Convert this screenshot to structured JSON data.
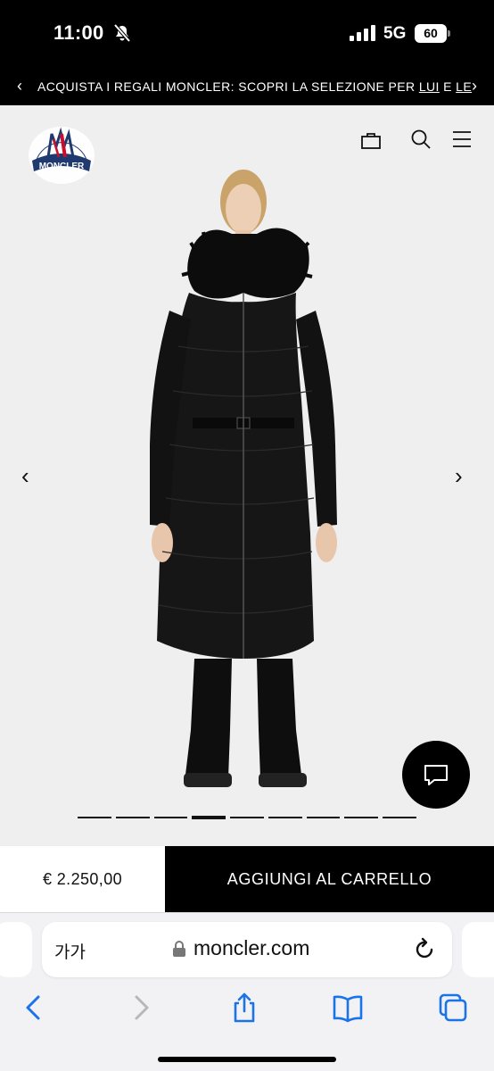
{
  "status_bar": {
    "time": "11:00",
    "network": "5G",
    "battery": "60"
  },
  "promo": {
    "text": "ACQUISTA I REGALI MONCLER: SCOPRI LA SELEZIONE PER ",
    "link_him": "LUI",
    "conjunction": " E ",
    "link_her": "LE",
    "prev_glyph": "‹",
    "next_glyph": "›"
  },
  "header": {
    "brand": "MONCLER",
    "icons": [
      "shopping-bag-icon",
      "search-icon",
      "menu-icon"
    ]
  },
  "gallery": {
    "prev_glyph": "‹",
    "next_glyph": "›",
    "image_count": 9,
    "active_index": 3
  },
  "buy_bar": {
    "price": "€ 2.250,00",
    "add_to_cart": "AGGIUNGI AL CARRELLO"
  },
  "browser": {
    "text_size_label": "가가",
    "url": "moncler.com"
  },
  "colors": {
    "black": "#000000",
    "page_bg": "#efefef",
    "logo_red": "#c8102e",
    "logo_blue": "#1f3a6e",
    "safari_blue": "#1a73e8"
  }
}
